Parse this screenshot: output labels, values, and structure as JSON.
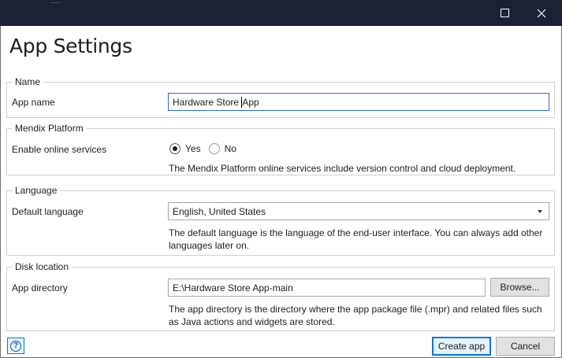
{
  "window": {
    "maximize_icon": "maximize-icon",
    "close_icon": "close-icon",
    "title_bar_color": "#1b2233"
  },
  "dialog": {
    "title": "App Settings"
  },
  "name_group": {
    "legend": "Name",
    "app_name_label": "App name",
    "app_name_value": "Hardware Store App",
    "app_name_before_caret": "Hardware Store ",
    "app_name_after_caret": "App"
  },
  "platform_group": {
    "legend": "Mendix Platform",
    "online_services_label": "Enable online services",
    "options": [
      {
        "label": "Yes",
        "selected": true
      },
      {
        "label": "No",
        "selected": false
      }
    ],
    "help": "The Mendix Platform online services include version control and cloud deployment."
  },
  "language_group": {
    "legend": "Language",
    "default_language_label": "Default language",
    "default_language_value": "English, United States",
    "help_line1": "The default language is the language of the end-user interface. You can always add other",
    "help_line2": "languages later on."
  },
  "disk_group": {
    "legend": "Disk location",
    "app_directory_label": "App directory",
    "app_directory_value": "E:\\Hardware Store App-main",
    "browse_label": "Browse...",
    "help_line1": "The app directory is the directory where the app package file (.mpr) and related files such",
    "help_line2": "as Java actions and widgets are stored."
  },
  "footer": {
    "help_icon": "help-icon",
    "help_glyph": "?",
    "create_label": "Create app",
    "cancel_label": "Cancel",
    "accent_color": "#0078d7"
  }
}
